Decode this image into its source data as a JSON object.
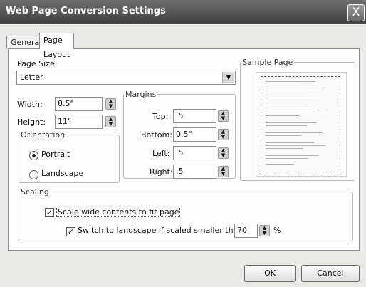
{
  "window": {
    "title": "Web Page Conversion Settings",
    "close_glyph": "X"
  },
  "tabs": [
    {
      "label": "General"
    },
    {
      "label": "Page Layout"
    }
  ],
  "page_size": {
    "label": "Page Size:",
    "value": "Letter"
  },
  "width": {
    "label": "Width:",
    "value": "8.5\""
  },
  "height": {
    "label": "Height:",
    "value": "11\""
  },
  "orientation": {
    "label": "Orientation",
    "portrait": "Portrait",
    "landscape": "Landscape",
    "selected": "Portrait"
  },
  "margins": {
    "label": "Margins",
    "top": {
      "label": "Top:",
      "value": ".5"
    },
    "bottom": {
      "label": "Bottom:",
      "value": "0.5\""
    },
    "left": {
      "label": "Left:",
      "value": ".5"
    },
    "right": {
      "label": "Right:",
      "value": ".5"
    }
  },
  "sample": {
    "label": "Sample Page"
  },
  "scaling": {
    "label": "Scaling",
    "scale_wide": {
      "label": "Scale wide contents to fit page",
      "checked": true
    },
    "switch_landscape": {
      "label": "Switch to landscape if scaled smaller than:",
      "checked": true,
      "value": "70",
      "unit": "%"
    }
  },
  "buttons": {
    "ok": "OK",
    "cancel": "Cancel"
  }
}
